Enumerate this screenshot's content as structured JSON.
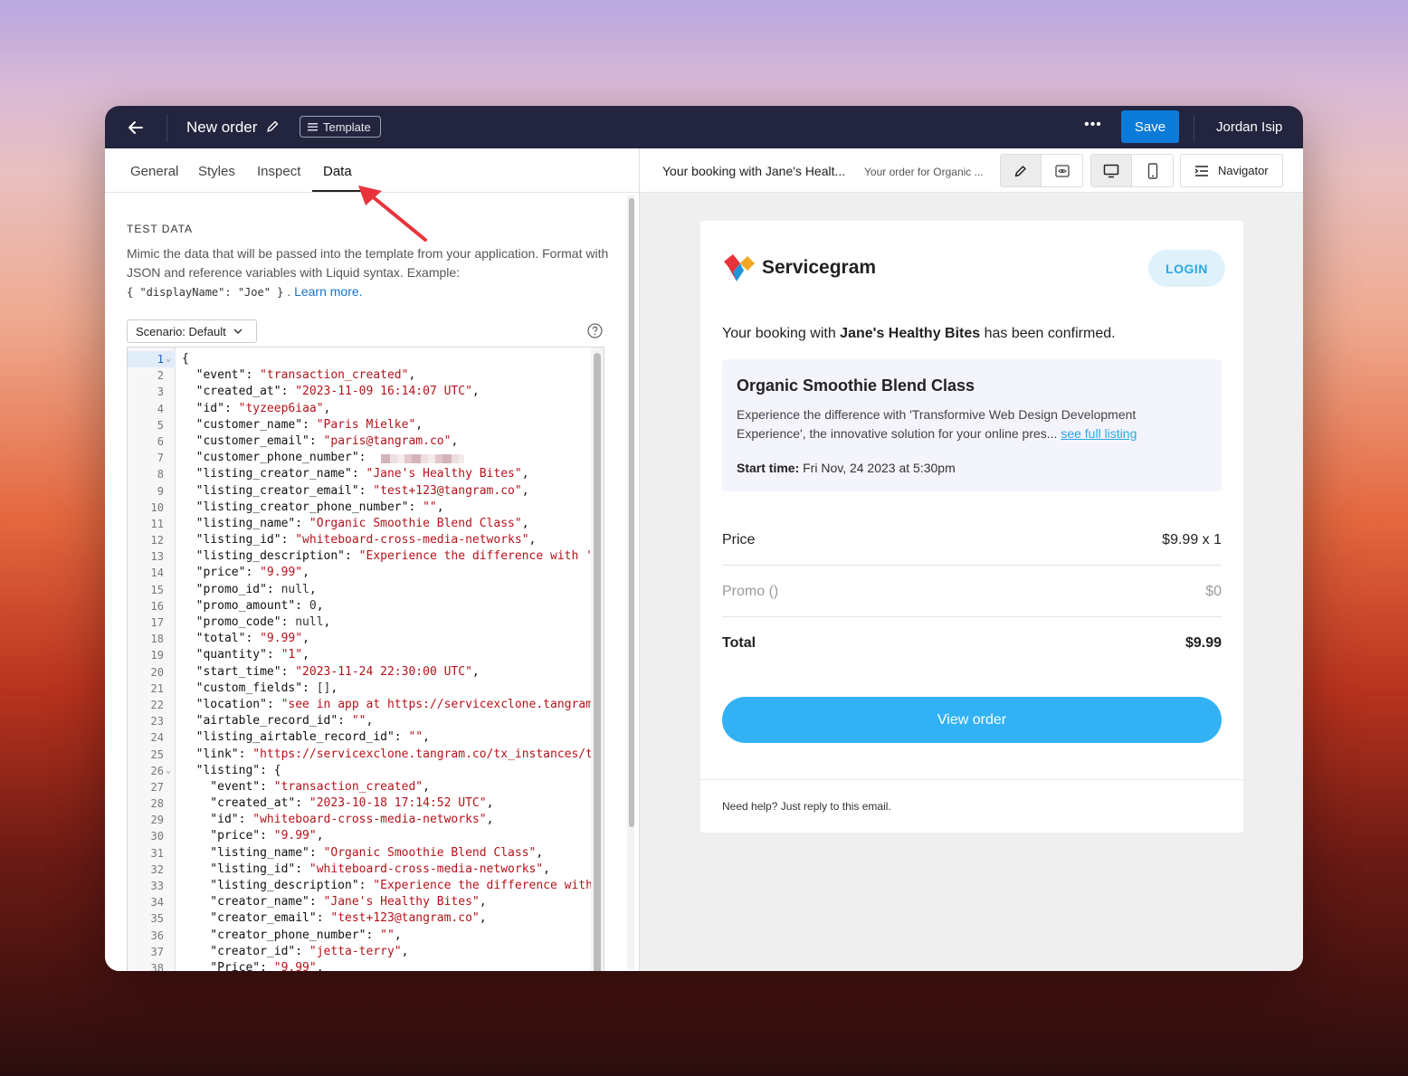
{
  "topbar": {
    "back_icon": "arrow-left-icon",
    "title": "New order",
    "template_badge": "Template",
    "more": "•••",
    "save_label": "Save",
    "user_name": "Jordan Isip"
  },
  "tabs": [
    {
      "label": "General"
    },
    {
      "label": "Styles"
    },
    {
      "label": "Inspect"
    },
    {
      "label": "Data",
      "active": true
    }
  ],
  "test_data": {
    "heading": "TEST DATA",
    "desc_1": "Mimic the data that will be passed into the template from your application. Format with JSON and reference variables with Liquid syntax. Example:",
    "example_code": "{ \"displayName\": \"Joe\" }",
    "desc_sep": " . ",
    "learn_more": "Learn more.",
    "scenario_label": "Scenario: Default"
  },
  "code_lines": [
    {
      "n": "1",
      "fold": "⌄",
      "key": "{",
      "val": ""
    },
    {
      "n": "2",
      "fold": "",
      "key": "  \"event\": ",
      "val": "\"transaction_created\"",
      "tail": ","
    },
    {
      "n": "3",
      "fold": "",
      "key": "  \"created_at\": ",
      "val": "\"2023-11-09 16:14:07 UTC\"",
      "tail": ","
    },
    {
      "n": "4",
      "fold": "",
      "key": "  \"id\": ",
      "val": "\"tyzeep6iaa\"",
      "tail": ","
    },
    {
      "n": "5",
      "fold": "",
      "key": "  \"customer_name\": ",
      "val": "\"Paris Mielke\"",
      "tail": ","
    },
    {
      "n": "6",
      "fold": "",
      "key": "  \"customer_email\": ",
      "val": "\"paris@tangram.co\"",
      "tail": ","
    },
    {
      "n": "7",
      "fold": "",
      "key": "  \"customer_phone_number\": ",
      "val": "",
      "tail": ""
    },
    {
      "n": "8",
      "fold": "",
      "key": "  \"listing_creator_name\": ",
      "val": "\"Jane's Healthy Bites\"",
      "tail": ","
    },
    {
      "n": "9",
      "fold": "",
      "key": "  \"listing_creator_email\": ",
      "val": "\"test+123@tangram.co\"",
      "tail": ","
    },
    {
      "n": "10",
      "fold": "",
      "key": "  \"listing_creator_phone_number\": ",
      "val": "\"\"",
      "tail": ","
    },
    {
      "n": "11",
      "fold": "",
      "key": "  \"listing_name\": ",
      "val": "\"Organic Smoothie Blend Class\"",
      "tail": ","
    },
    {
      "n": "12",
      "fold": "",
      "key": "  \"listing_id\": ",
      "val": "\"whiteboard-cross-media-networks\"",
      "tail": ","
    },
    {
      "n": "13",
      "fold": "",
      "key": "  \"listing_description\": ",
      "val": "\"Experience the difference with '",
      "tail": ""
    },
    {
      "n": "14",
      "fold": "",
      "key": "  \"price\": ",
      "val": "\"9.99\"",
      "tail": ","
    },
    {
      "n": "15",
      "fold": "",
      "key": "  \"promo_id\": ",
      "val": "null",
      "tail": ",",
      "plain": true
    },
    {
      "n": "16",
      "fold": "",
      "key": "  \"promo_amount\": ",
      "val": "0",
      "tail": ",",
      "plain": true
    },
    {
      "n": "17",
      "fold": "",
      "key": "  \"promo_code\": ",
      "val": "null",
      "tail": ",",
      "plain": true
    },
    {
      "n": "18",
      "fold": "",
      "key": "  \"total\": ",
      "val": "\"9.99\"",
      "tail": ","
    },
    {
      "n": "19",
      "fold": "",
      "key": "  \"quantity\": ",
      "val": "\"1\"",
      "tail": ","
    },
    {
      "n": "20",
      "fold": "",
      "key": "  \"start_time\": ",
      "val": "\"2023-11-24 22:30:00 UTC\"",
      "tail": ","
    },
    {
      "n": "21",
      "fold": "",
      "key": "  \"custom_fields\": ",
      "val": "[]",
      "tail": ",",
      "plain": true
    },
    {
      "n": "22",
      "fold": "",
      "key": "  \"location\": ",
      "val": "\"see in app at https://servicexclone.tangram",
      "tail": ""
    },
    {
      "n": "23",
      "fold": "",
      "key": "  \"airtable_record_id\": ",
      "val": "\"\"",
      "tail": ","
    },
    {
      "n": "24",
      "fold": "",
      "key": "  \"listing_airtable_record_id\": ",
      "val": "\"\"",
      "tail": ","
    },
    {
      "n": "25",
      "fold": "",
      "key": "  \"link\": ",
      "val": "\"https://servicexclone.tangram.co/tx_instances/t",
      "tail": ""
    },
    {
      "n": "26",
      "fold": "⌄",
      "key": "  \"listing\": {",
      "val": "",
      "tail": ""
    },
    {
      "n": "27",
      "fold": "",
      "key": "    \"event\": ",
      "val": "\"transaction_created\"",
      "tail": ","
    },
    {
      "n": "28",
      "fold": "",
      "key": "    \"created_at\": ",
      "val": "\"2023-10-18 17:14:52 UTC\"",
      "tail": ","
    },
    {
      "n": "29",
      "fold": "",
      "key": "    \"id\": ",
      "val": "\"whiteboard-cross-media-networks\"",
      "tail": ","
    },
    {
      "n": "30",
      "fold": "",
      "key": "    \"price\": ",
      "val": "\"9.99\"",
      "tail": ","
    },
    {
      "n": "31",
      "fold": "",
      "key": "    \"listing_name\": ",
      "val": "\"Organic Smoothie Blend Class\"",
      "tail": ","
    },
    {
      "n": "32",
      "fold": "",
      "key": "    \"listing_id\": ",
      "val": "\"whiteboard-cross-media-networks\"",
      "tail": ","
    },
    {
      "n": "33",
      "fold": "",
      "key": "    \"listing_description\": ",
      "val": "\"Experience the difference with",
      "tail": ""
    },
    {
      "n": "34",
      "fold": "",
      "key": "    \"creator_name\": ",
      "val": "\"Jane's Healthy Bites\"",
      "tail": ","
    },
    {
      "n": "35",
      "fold": "",
      "key": "    \"creator_email\": ",
      "val": "\"test+123@tangram.co\"",
      "tail": ","
    },
    {
      "n": "36",
      "fold": "",
      "key": "    \"creator_phone_number\": ",
      "val": "\"\"",
      "tail": ","
    },
    {
      "n": "37",
      "fold": "",
      "key": "    \"creator_id\": ",
      "val": "\"jetta-terry\"",
      "tail": ","
    },
    {
      "n": "38",
      "fold": "",
      "key": "    \"Price\": ",
      "val": "\"9.99\"",
      "tail": ","
    }
  ],
  "preview_toolbar": {
    "subject": "Your booking with Jane's Healt...",
    "preheader": "Your order for Organic ...",
    "navigator_label": "Navigator"
  },
  "email": {
    "brand_name": "Servicegram",
    "login_label": "LOGIN",
    "confirm_prefix": "Your booking with ",
    "confirm_business": "Jane's Healthy Bites",
    "confirm_suffix": " has been confirmed.",
    "listing_title": "Organic Smoothie Blend Class",
    "listing_desc": "Experience the difference with 'Transformive Web Design Development Experience', the innovative solution for your online pres... ",
    "listing_link": "see full listing",
    "start_time_label": "Start time:",
    "start_time_value": " Fri Nov, 24 2023 at 5:30pm",
    "price_label": "Price",
    "price_value": "$9.99 x 1",
    "promo_label": "Promo ()",
    "promo_value": "$0",
    "total_label": "Total",
    "total_value": "$9.99",
    "view_order_label": "View order",
    "footer_text": "Need help? Just reply to this email."
  },
  "colors": {
    "topbar_bg": "#23253f",
    "save_bg": "#0b7bd9",
    "string_red": "#b5121b",
    "login_text": "#2aa7e6",
    "view_order_bg": "#32b2f5",
    "arrow_red": "#e8333c"
  }
}
